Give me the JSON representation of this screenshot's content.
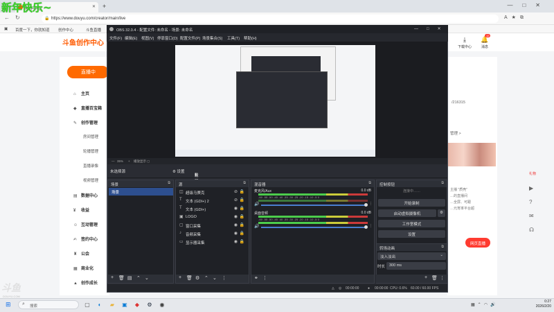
{
  "overlay_text": "新年快乐~",
  "browser": {
    "tab_title": "创作中心",
    "tab_close": "✕",
    "new_tab": "+",
    "url": "https://www.douyu.com/creator/main/live",
    "bookmarks": [
      "百度一下，你就知道",
      "创作中心",
      "斗鱼直播"
    ],
    "window_controls": [
      "—",
      "□",
      "✕"
    ]
  },
  "page": {
    "logo": "斗鱼创作中心",
    "download_center": "下载中心",
    "messages": "消息",
    "messages_badge": "12",
    "live_button": "直播中",
    "sidebar": [
      {
        "label": "主页",
        "icon": "home-icon"
      },
      {
        "label": "直播百宝箱",
        "icon": "box-icon"
      },
      {
        "label": "创作管理",
        "icon": "create-icon"
      },
      {
        "label": "数据中心",
        "icon": "chart-icon"
      },
      {
        "label": "收益",
        "icon": "money-icon"
      },
      {
        "label": "互动管理",
        "icon": "interact-icon"
      },
      {
        "label": "签约中心",
        "icon": "sign-icon"
      },
      {
        "label": "公会",
        "icon": "guild-icon"
      },
      {
        "label": "商业化",
        "icon": "business-icon"
      },
      {
        "label": "创作成长",
        "icon": "growth-icon"
      }
    ],
    "sub_items": [
      "房间管理",
      "轮播管理",
      "直播录像",
      "视频管理"
    ],
    "room_id": "/216315",
    "manage_link": "管理 >",
    "content_text_lines": [
      "主播 \"质壳\"",
      "…的直播间",
      "…全屏、可跟",
      "…元宵率平台超"
    ],
    "open_live": "网页直播",
    "rightrail_hot": "礼物"
  },
  "obs": {
    "title": "OBS 32.0.4 - 配置文件: 未命名 - 场景: 未命名",
    "menu": [
      "文件(F)",
      "编辑(E)",
      "视图(V)",
      "停靠窗口(D)",
      "配置文件(P)",
      "场景集合(S)",
      "工具(T)",
      "帮助(H)"
    ],
    "zoom": "35%",
    "zoom_mode": "播放显示 ◻",
    "no_source": "未选择源",
    "properties": "⚙ 设置",
    "filters": "滤镜",
    "docks": {
      "scenes": "场景",
      "sources": "源",
      "mixer": "混音器",
      "controls": "控制按钮",
      "transitions": "转场动画"
    },
    "scenes": [
      "场景"
    ],
    "sources": [
      "超级马赛克",
      "文本 (GDI+) 2",
      "文本 (GDI+)",
      "LOGO",
      "窗口采集",
      "音频采集",
      "显示器采集"
    ],
    "mixer": [
      {
        "name": "麦克风/Aux",
        "db": "0.0 dB"
      },
      {
        "name": "桌面音频",
        "db": "0.0 dB"
      }
    ],
    "meter_scale": "-60 -55 -50 -45 -40 -35 -30 -25 -20 -15 -10 -5 0",
    "controls": {
      "status": "连接中……",
      "start_record": "开始录制",
      "virtual_cam": "启动虚拟摄像机",
      "studio_mode": "工作室模式",
      "settings": "设置"
    },
    "transition": {
      "type": "淡入淡出",
      "duration_label": "时长",
      "duration": "300 ms"
    },
    "status": {
      "rec_time": "00:00:00",
      "stream_time": "00:00:00",
      "cpu": "CPU: 0.6%",
      "fps": "60.00 / 60.00 FPS"
    }
  },
  "watermark": "斗鱼",
  "watermark_sub": "DOUYU.COM",
  "taskbar": {
    "search_placeholder": "搜索",
    "time": "0:27",
    "date": "2026/2/20"
  }
}
